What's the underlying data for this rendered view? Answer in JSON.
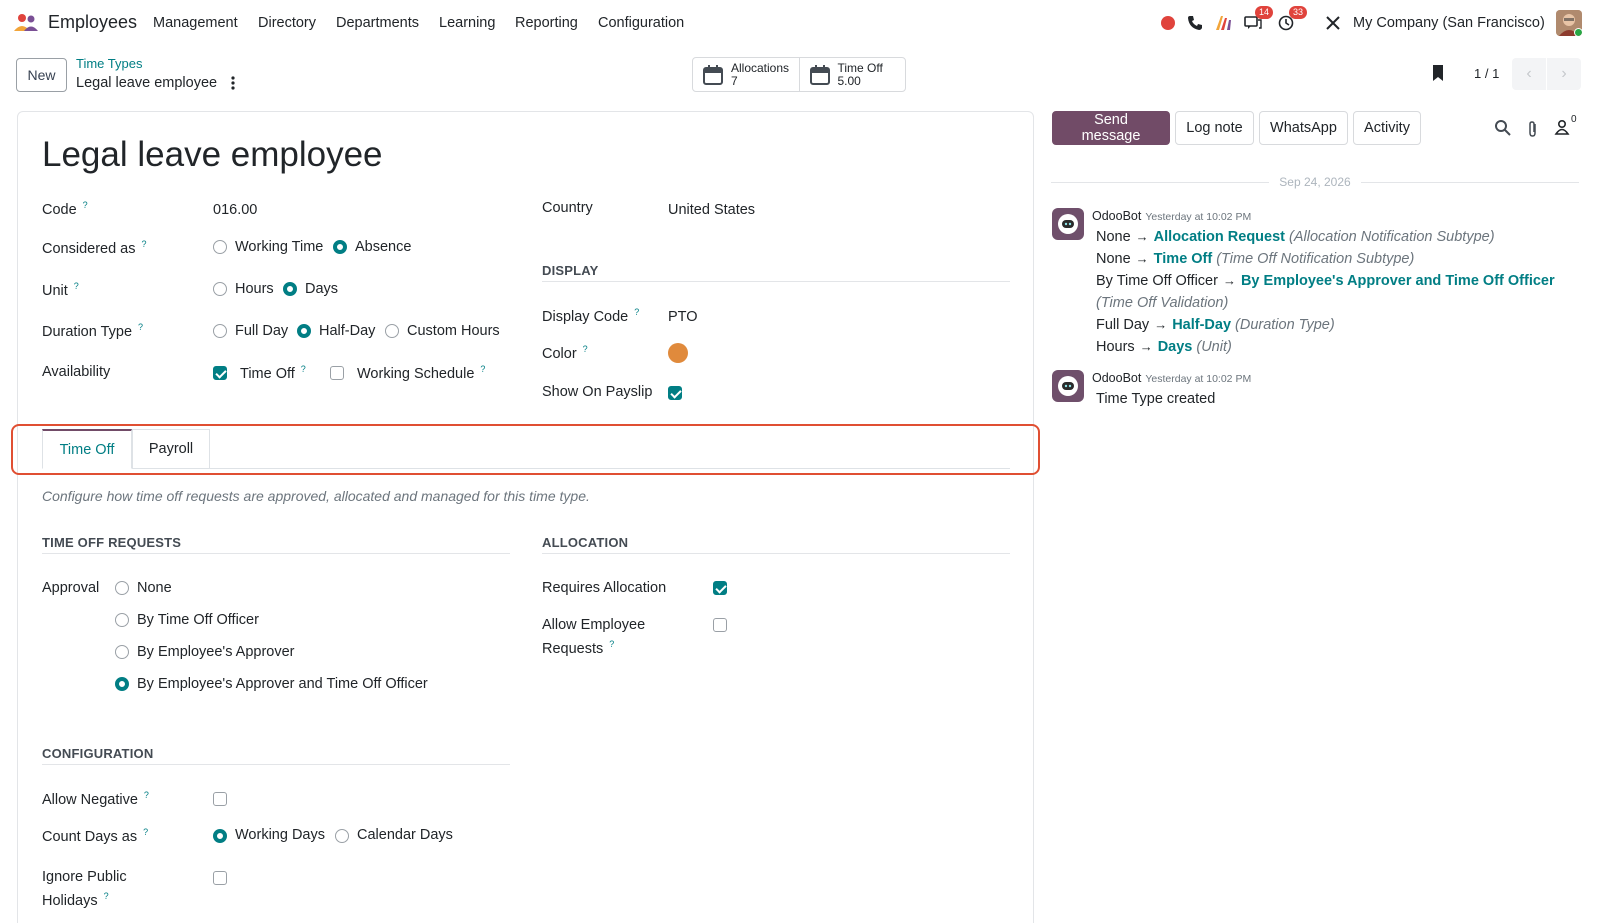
{
  "app": {
    "name": "Employees"
  },
  "menu": [
    "Management",
    "Directory",
    "Departments",
    "Learning",
    "Reporting",
    "Configuration"
  ],
  "systray": {
    "messages_count": "14",
    "activities_count": "33",
    "company": "My Company (San Francisco)"
  },
  "control_panel": {
    "new_label": "New",
    "breadcrumb_parent": "Time Types",
    "breadcrumb_current": "Legal leave employee",
    "smart_buttons": [
      {
        "label": "Allocations",
        "value": "7"
      },
      {
        "label": "Time Off",
        "value": "5.00"
      }
    ],
    "pager": "1 / 1"
  },
  "form": {
    "title": "Legal leave employee",
    "code_label": "Code",
    "code_value": "016.00",
    "considered_label": "Considered as",
    "considered_options": [
      "Working Time",
      "Absence"
    ],
    "considered_selected": "Absence",
    "unit_label": "Unit",
    "unit_options": [
      "Hours",
      "Days"
    ],
    "unit_selected": "Days",
    "duration_label": "Duration Type",
    "duration_options": [
      "Full Day",
      "Half-Day",
      "Custom Hours"
    ],
    "duration_selected": "Half-Day",
    "availability_label": "Availability",
    "availability_time_off": "Time Off",
    "availability_time_off_checked": true,
    "availability_working": "Working Schedule",
    "availability_working_checked": false,
    "country_label": "Country",
    "country_value": "United States",
    "display_section": "DISPLAY",
    "display_code_label": "Display Code",
    "display_code_value": "PTO",
    "color_label": "Color",
    "color_value": "#e08a3c",
    "payslip_label": "Show On Payslip",
    "payslip_checked": true,
    "help_mark": "?"
  },
  "tabs": [
    {
      "label": "Time Off",
      "active": true
    },
    {
      "label": "Payroll",
      "active": false
    }
  ],
  "time_off_tab": {
    "description": "Configure how time off requests are approved, allocated and managed for this time type.",
    "requests_section": "TIME OFF REQUESTS",
    "approval_label": "Approval",
    "approval_options": [
      "None",
      "By Time Off Officer",
      "By Employee's Approver",
      "By Employee's Approver and Time Off Officer"
    ],
    "approval_selected": "By Employee's Approver and Time Off Officer",
    "allocation_section": "ALLOCATION",
    "requires_allocation_label": "Requires Allocation",
    "requires_allocation_checked": true,
    "allow_requests_label_1": "Allow Employee",
    "allow_requests_label_2": "Requests",
    "allow_requests_checked": false,
    "configuration_section": "CONFIGURATION",
    "allow_negative_label": "Allow Negative",
    "allow_negative_checked": false,
    "count_days_label": "Count Days as",
    "count_days_options": [
      "Working Days",
      "Calendar Days"
    ],
    "count_days_selected": "Working Days",
    "ignore_holidays_label_1": "Ignore Public",
    "ignore_holidays_label_2": "Holidays",
    "ignore_holidays_checked": false
  },
  "chatter": {
    "buttons": [
      "Send message",
      "Log note",
      "WhatsApp",
      "Activity"
    ],
    "followers_count": "0",
    "date_separator": "Sep 24, 2026",
    "messages": [
      {
        "author": "OdooBot",
        "time": "Yesterday at 10:02 PM",
        "tracking": [
          {
            "old": "None",
            "new": "Allocation Request",
            "field": "(Allocation Notification Subtype)"
          },
          {
            "old": "None",
            "new": "Time Off",
            "field": "(Time Off Notification Subtype)"
          },
          {
            "old": "By Time Off Officer",
            "new": "By Employee's Approver and Time Off Officer",
            "field": ""
          },
          {
            "old": "Full Day",
            "new": "Half-Day",
            "field": "(Duration Type)"
          },
          {
            "old": "Hours",
            "new": "Days",
            "field": "(Unit)"
          }
        ],
        "wrapped_field": "(Time Off Validation)"
      },
      {
        "author": "OdooBot",
        "time": "Yesterday at 10:02 PM",
        "body": "Time Type created"
      }
    ]
  },
  "colors": {
    "primary": "#714b67",
    "accent": "#017e84",
    "highlight": "#e04f32"
  }
}
